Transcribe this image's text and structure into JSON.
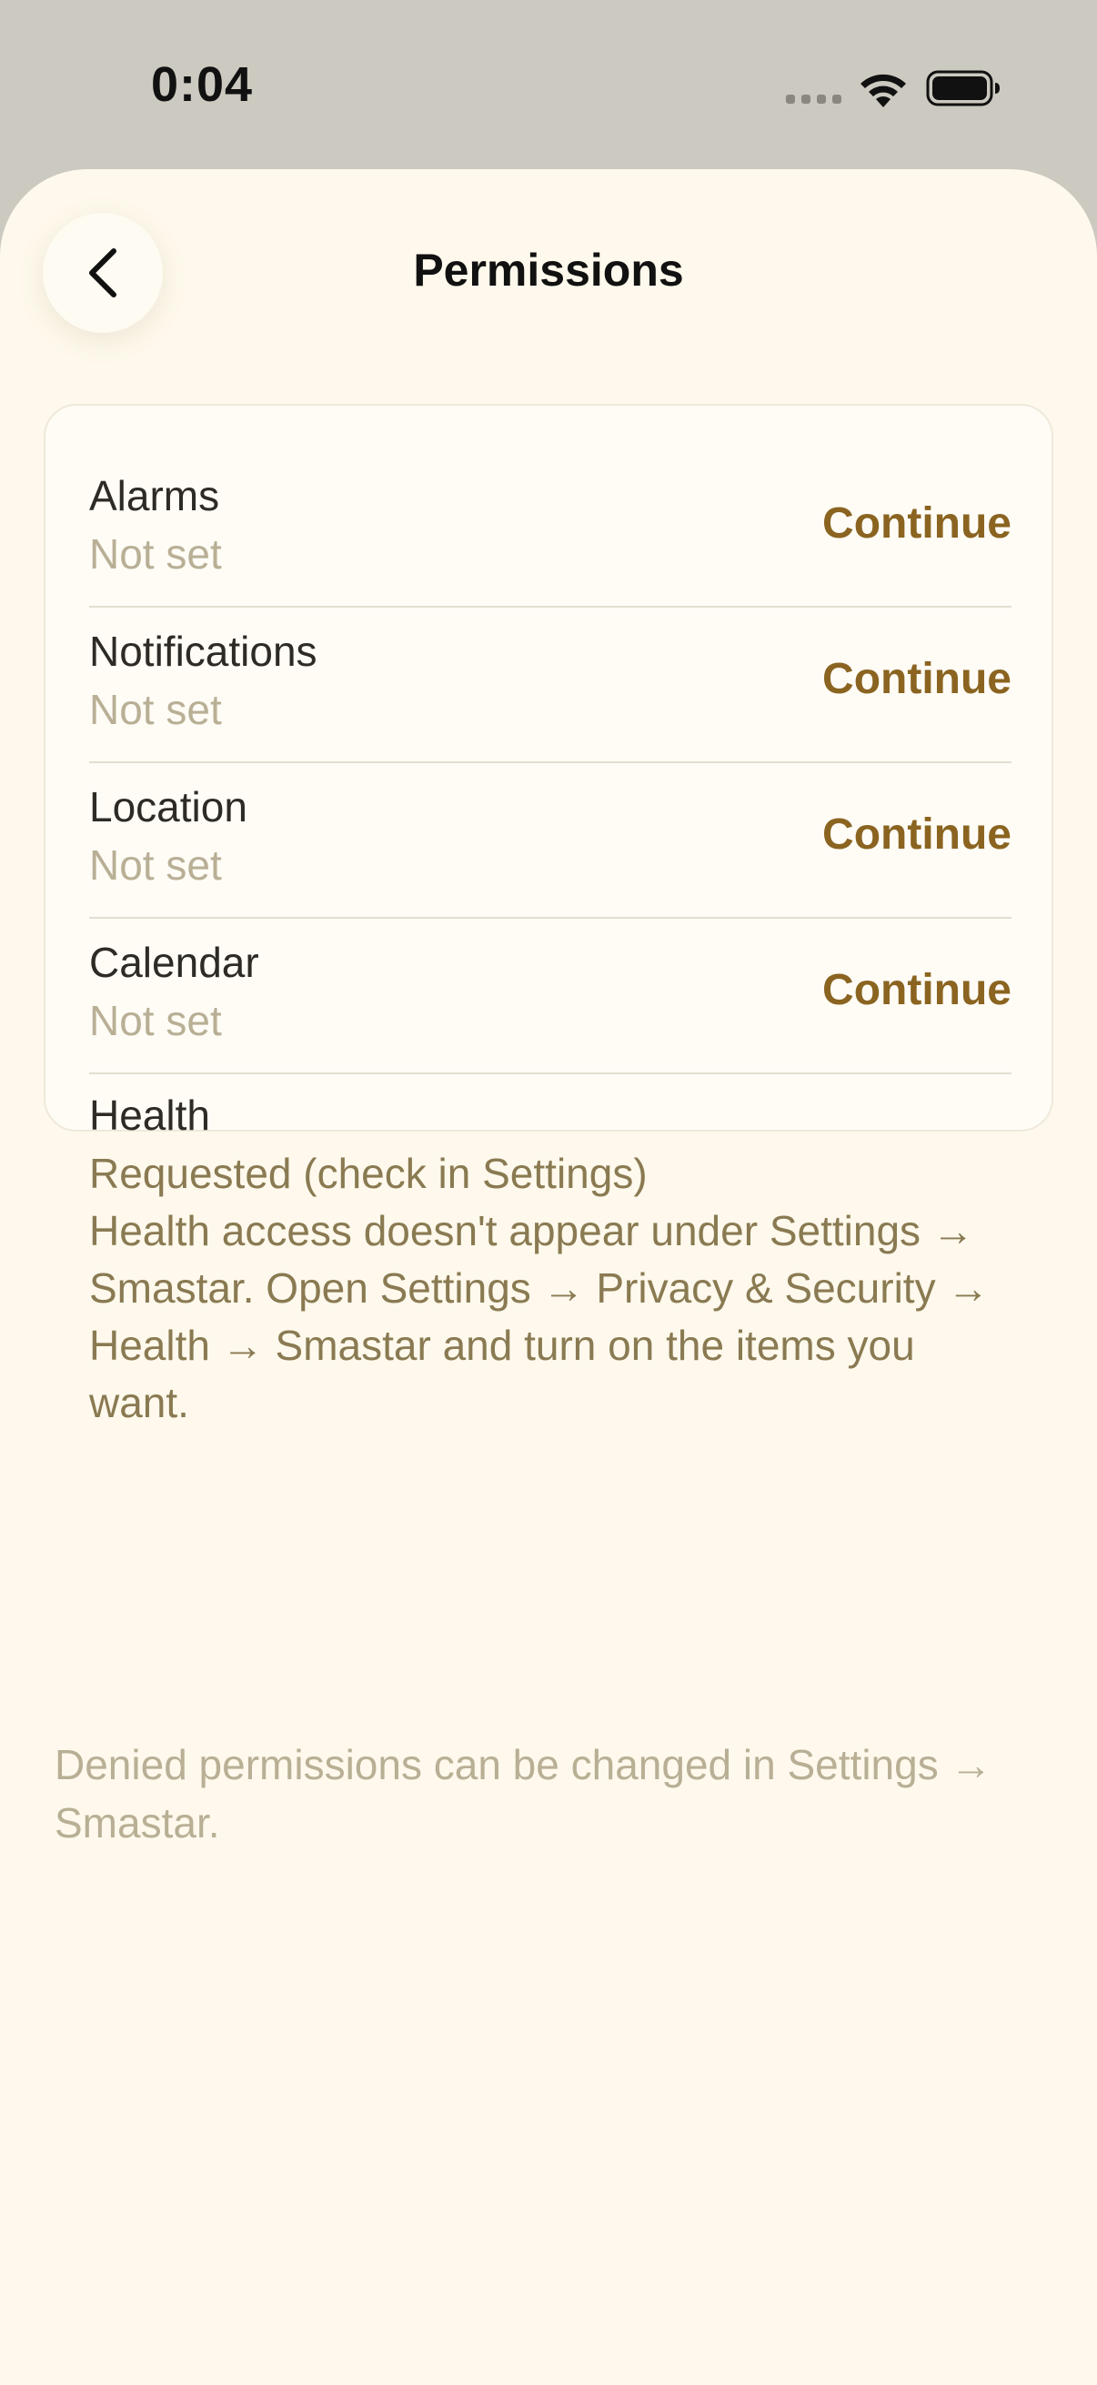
{
  "status_bar": {
    "time": "0:04",
    "icons": [
      "signal-dots-icon",
      "wifi-icon",
      "battery-icon"
    ]
  },
  "header": {
    "title": "Permissions",
    "back_icon": "chevron-left-icon"
  },
  "permissions": [
    {
      "title": "Alarms",
      "status": "Not set",
      "action": "Continue"
    },
    {
      "title": "Notifications",
      "status": "Not set",
      "action": "Continue"
    },
    {
      "title": "Location",
      "status": "Not set",
      "action": "Continue"
    },
    {
      "title": "Calendar",
      "status": "Not set",
      "action": "Continue"
    }
  ],
  "health": {
    "title": "Health",
    "status": "Requested (check in Settings)",
    "note": "Health access doesn't appear under Settings → Smastar. Open Settings → Privacy & Security → Health → Smastar and turn on the items you want."
  },
  "footer": {
    "note": "Denied permissions can be changed in Settings → Smastar."
  },
  "colors": {
    "background": "#FEF9EC",
    "status_bar_bg": "#CCC9C0",
    "accent": "#8A6420",
    "muted_text": "#B8AF95",
    "body_text": "#2E2B24",
    "health_text": "#8A7A52"
  }
}
